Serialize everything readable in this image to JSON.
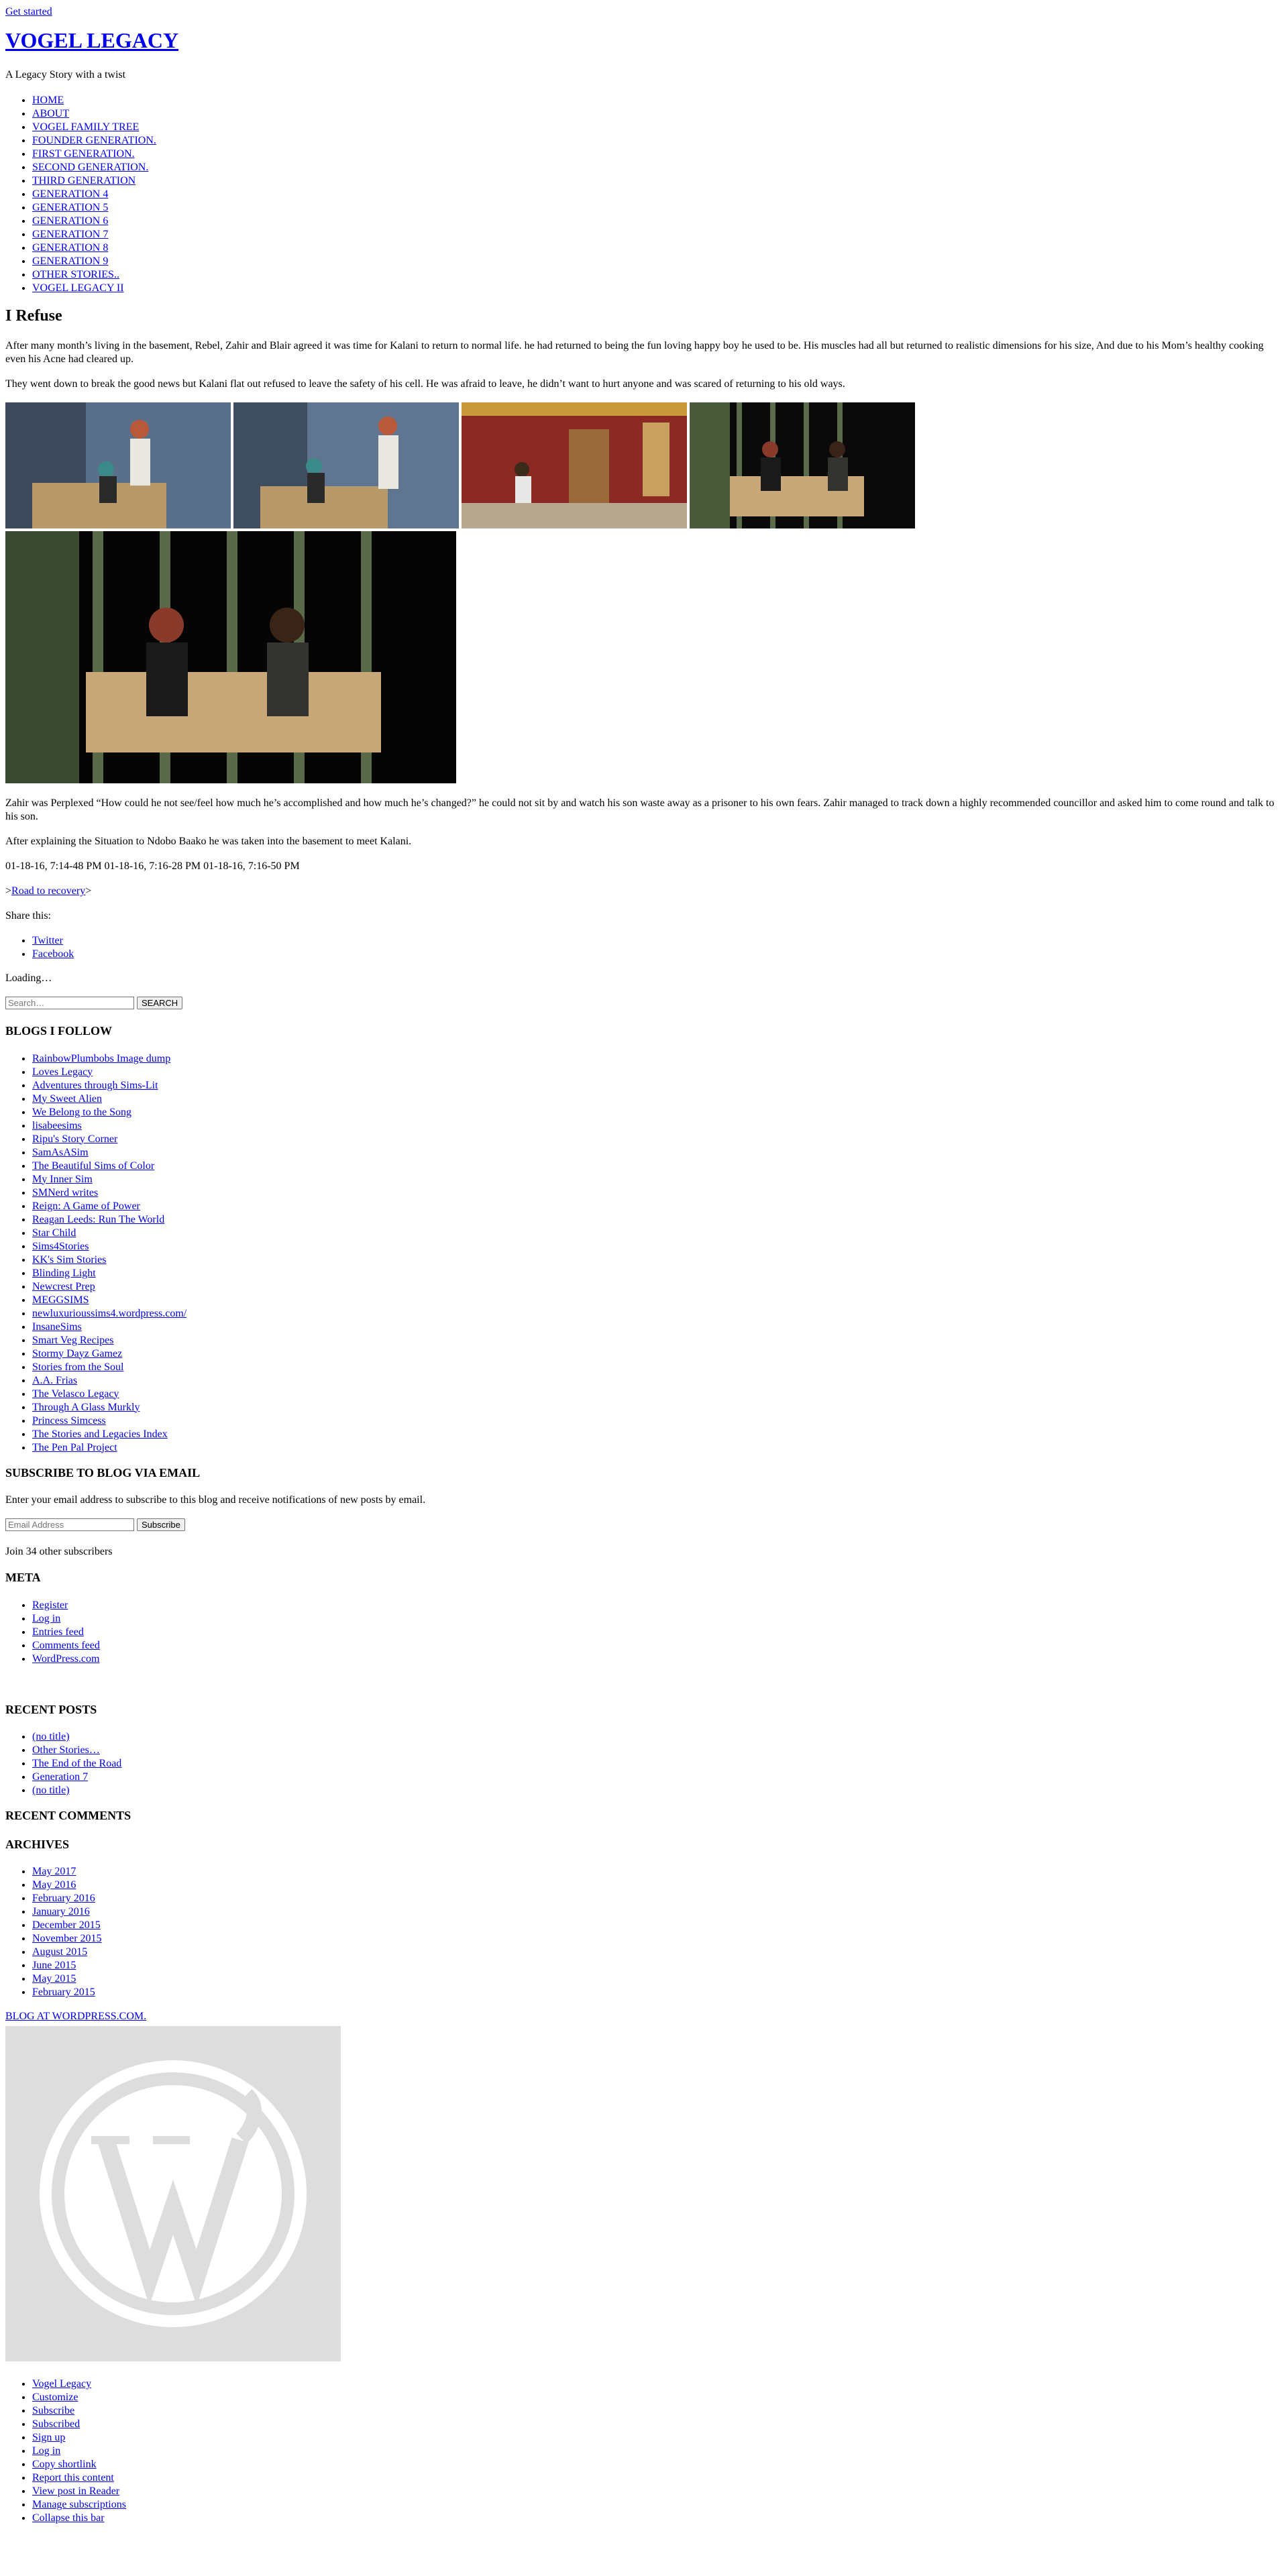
{
  "top_link": "Get started",
  "site": {
    "title": "VOGEL LEGACY",
    "description": "A Legacy Story with a twist"
  },
  "nav": [
    "HOME",
    "ABOUT",
    "VOGEL FAMILY TREE",
    "FOUNDER GENERATION.",
    "FIRST GENERATION.",
    "SECOND GENERATION.",
    "THIRD GENERATION",
    "GENERATION 4",
    "GENERATION 5",
    "GENERATION 6",
    "GENERATION 7",
    "GENERATION 8",
    "GENERATION 9",
    "OTHER STORIES..",
    "VOGEL LEGACY II"
  ],
  "post": {
    "title": "I Refuse",
    "para1": "After many month’s living in the basement, Rebel, Zahir and Blair agreed it was time for Kalani to return to normal life. he had returned to being the fun loving happy boy he used to be. His muscles had all but returned to realistic dimensions for his size, And due to his Mom’s healthy cooking even his Acne had cleared up.",
    "para2": "They went down to break the good news but Kalani flat out refused to leave the safety of his cell. He was afraid to leave, he didn’t want to hurt anyone and was scared of returning to his old ways.",
    "para3": "Zahir was Perplexed “How could he not see/feel how much he’s accomplished and how much he’s changed?” he could not sit by and watch his son waste away as a prisoner to his own fears. Zahir managed to track down a highly recommended councillor and asked him to come round and talk to his son.",
    "para4": "After explaining the Situation to Ndobo Baako he was taken into the basement to meet Kalani.",
    "image_captions": "01-18-16, 7:14-48 PM 01-18-16, 7:16-28 PM 01-18-16, 7:16-50 PM",
    "next_link": "Road to recovery",
    "share_label": "Share this:",
    "share_links": [
      "Twitter",
      "Facebook"
    ],
    "loading": "Loading…"
  },
  "search": {
    "placeholder": "Search…",
    "button": "SEARCH"
  },
  "blogs_follow": {
    "title": "BLOGS I FOLLOW",
    "items": [
      "RainbowPlumbobs Image dump",
      "Loves Legacy",
      "Adventures through Sims-Lit",
      "My Sweet Alien",
      "We Belong to the Song",
      "lisabeesims",
      "Ripu's Story Corner",
      "SamAsASim",
      "The Beautiful Sims of Color",
      "My Inner Sim",
      "SMNerd writes",
      "Reign: A Game of Power",
      "Reagan Leeds: Run The World",
      "Star Child",
      "Sims4Stories",
      "KK's Sim Stories",
      "Blinding Light",
      "Newcrest Prep",
      "MEGGSIMS",
      "newluxurioussims4.wordpress.com/",
      "InsaneSims",
      "Smart Veg Recipes",
      "Stormy Dayz Gamez",
      "Stories from the Soul",
      "A.A. Frias",
      "The Velasco Legacy",
      "Through A Glass Murkly",
      "Princess Simcess",
      "The Stories and Legacies Index",
      "The Pen Pal Project"
    ]
  },
  "subscribe": {
    "title": "SUBSCRIBE TO BLOG VIA EMAIL",
    "text": "Enter your email address to subscribe to this blog and receive notifications of new posts by email.",
    "placeholder": "Email Address",
    "button": "Subscribe",
    "count_text": "Join 34 other subscribers"
  },
  "meta": {
    "title": "META",
    "items": [
      "Register",
      "Log in",
      "Entries feed",
      "Comments feed",
      "WordPress.com"
    ]
  },
  "recent_posts": {
    "title": "RECENT POSTS",
    "items": [
      "(no title)",
      "Other Stories…",
      "The End of the Road",
      "Generation 7",
      "(no title)"
    ]
  },
  "recent_comments": {
    "title": "RECENT COMMENTS"
  },
  "archives": {
    "title": "ARCHIVES",
    "items": [
      "May 2017",
      "May 2016",
      "February 2016",
      "January 2016",
      "December 2015",
      "November 2015",
      "August 2015",
      "June 2015",
      "May 2015",
      "February 2015"
    ]
  },
  "footer_credit": "BLOG AT WORDPRESS.COM.",
  "bottom_bar": [
    "Vogel Legacy",
    "Customize",
    "Subscribe",
    "Subscribed",
    "Sign up",
    "Log in",
    "Copy shortlink",
    "Report this content",
    "View post in Reader",
    "Manage subscriptions",
    "Collapse this bar"
  ]
}
